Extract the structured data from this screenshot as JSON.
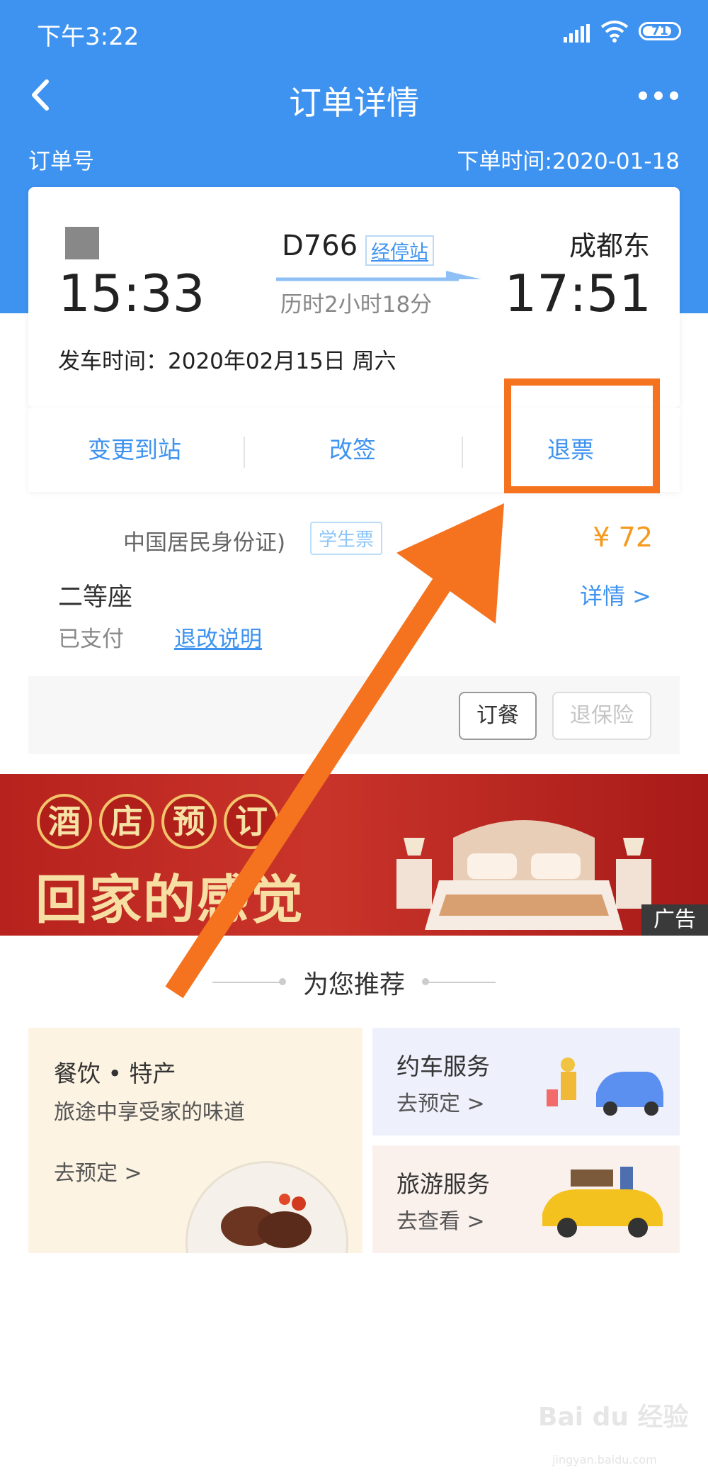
{
  "status_bar": {
    "time": "下午3:22",
    "battery": "71"
  },
  "nav": {
    "title": "订单详情"
  },
  "order": {
    "number_label": "订单号",
    "time_label": "下单时间:2020-01-18"
  },
  "ticket": {
    "departure_time": "15:33",
    "arrival_station": "成都东",
    "arrival_time": "17:51",
    "train_number": "D766",
    "stops_link": "经停站",
    "duration": "历时2小时18分",
    "depart_date": "发车时间：2020年02月15日 周六"
  },
  "actions": {
    "change_station": "变更到站",
    "reschedule": "改签",
    "refund": "退票"
  },
  "passenger": {
    "id_type": "中国居民身份证)",
    "ticket_type": "学生票",
    "price": "¥ 72",
    "seat_type": "二等座",
    "details": "详情 >",
    "pay_status": "已支付",
    "refund_rules": "退改说明"
  },
  "bottom_actions": {
    "meal": "订餐",
    "insurance": "退保险"
  },
  "banner": {
    "circles": [
      "酒",
      "店",
      "预",
      "订"
    ],
    "slogan": "回家的感觉",
    "ad_tag": "广告"
  },
  "recommend": {
    "title": "为您推荐",
    "food": {
      "title": "餐饮 • 特产",
      "subtitle": "旅途中享受家的味道",
      "action": "去预定 >"
    },
    "car": {
      "title": "约车服务",
      "action": "去预定 >"
    },
    "tour": {
      "title": "旅游服务",
      "action": "去查看 >"
    }
  },
  "watermark": {
    "text": "Bai du 经验",
    "sub": "jingyan.baidu.com"
  },
  "colors": {
    "primary": "#3e93f0",
    "highlight": "#f5731e",
    "price": "#f59a1e"
  }
}
